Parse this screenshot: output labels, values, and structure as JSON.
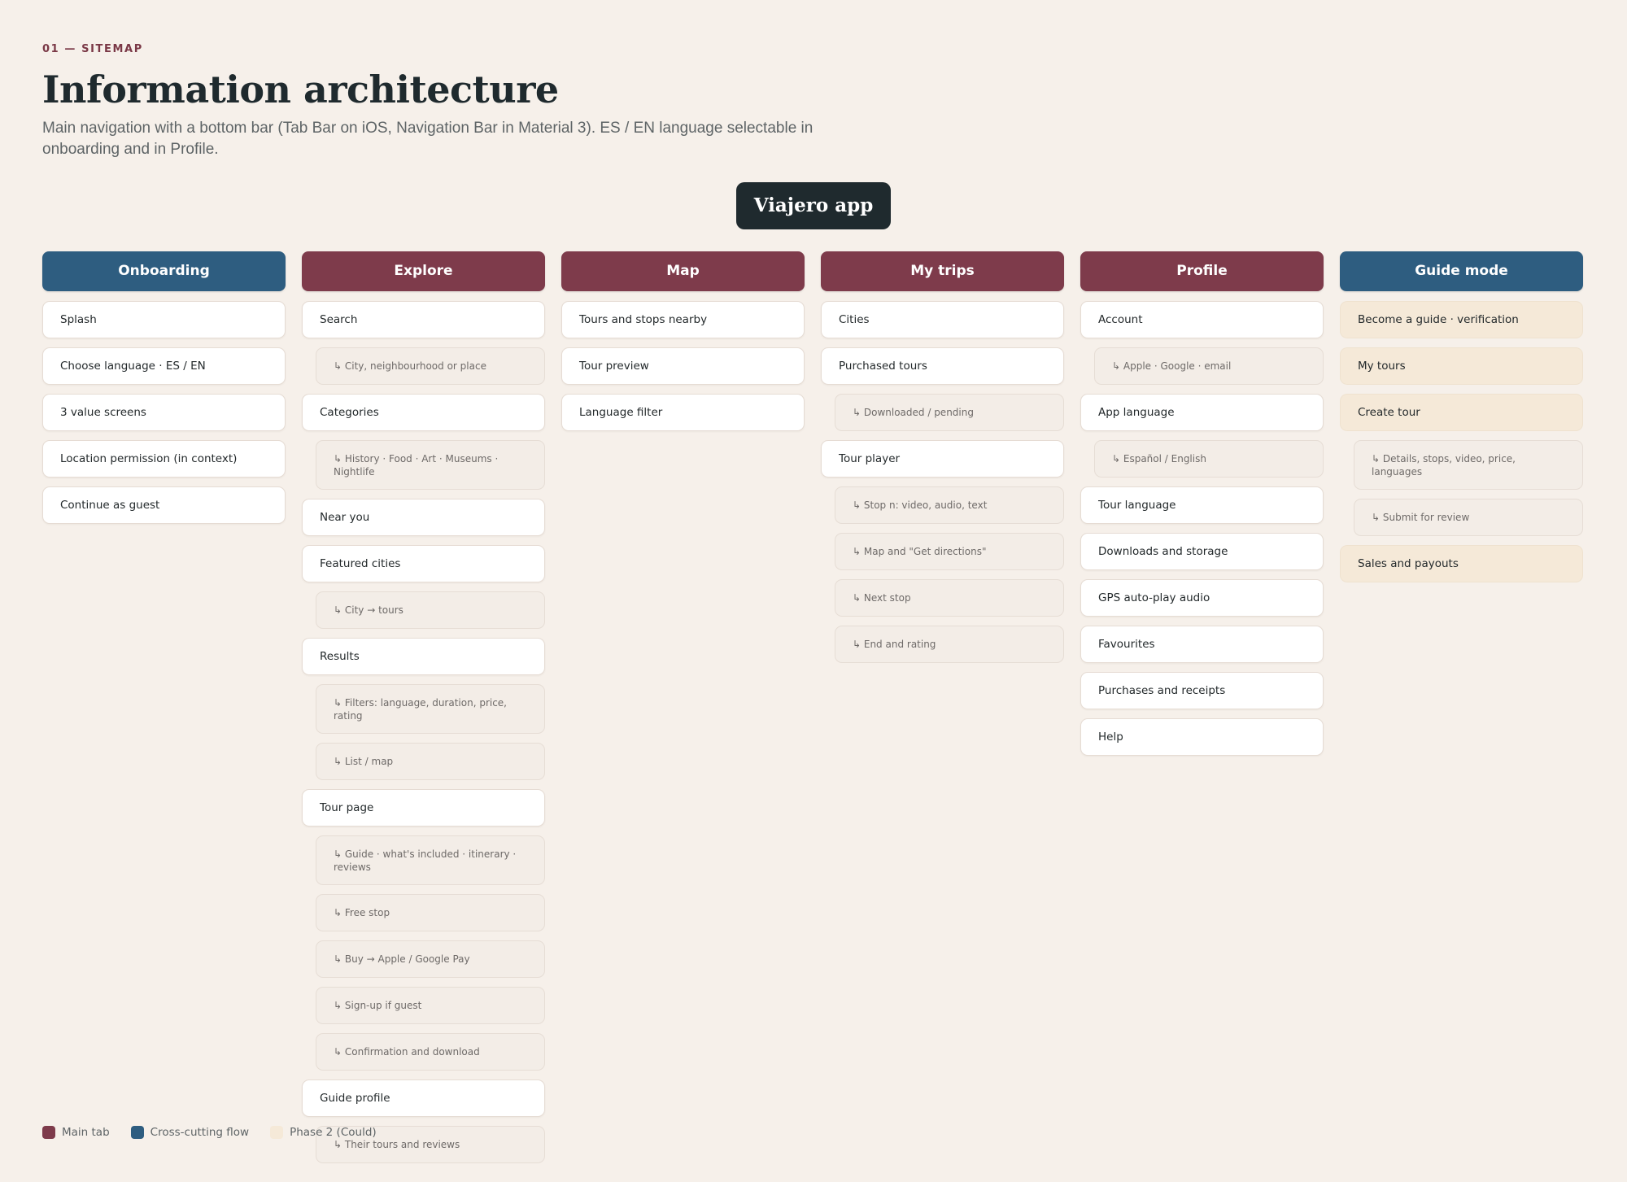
{
  "header": {
    "eyebrow": "01 — SITEMAP",
    "title": "Information architecture",
    "subtitle": "Main navigation with a bottom bar (Tab Bar on iOS, Navigation Bar in Material 3). ES / EN language selectable in onboarding and in Profile."
  },
  "root": {
    "label": "Viajero app"
  },
  "colors": {
    "main_tab": "#7e3b4b",
    "cross_cutting": "#2e5d80",
    "phase2": "#f5e9d8",
    "root": "#1f2a2e"
  },
  "columns": [
    {
      "title": "Onboarding",
      "kind": "cross",
      "items": [
        {
          "label": "Splash",
          "level": 0
        },
        {
          "label": "Choose language · ES / EN",
          "level": 0
        },
        {
          "label": "3 value screens",
          "level": 0
        },
        {
          "label": "Location permission (in context)",
          "level": 0
        },
        {
          "label": "Continue as guest",
          "level": 0
        }
      ]
    },
    {
      "title": "Explore",
      "kind": "main",
      "items": [
        {
          "label": "Search",
          "level": 0
        },
        {
          "label": "↳ City, neighbourhood or place",
          "level": 1
        },
        {
          "label": "Categories",
          "level": 0
        },
        {
          "label": "↳ History · Food · Art · Museums · Nightlife",
          "level": 1
        },
        {
          "label": "Near you",
          "level": 0
        },
        {
          "label": "Featured cities",
          "level": 0
        },
        {
          "label": "↳ City → tours",
          "level": 1
        },
        {
          "label": "Results",
          "level": 0
        },
        {
          "label": "↳ Filters: language, duration, price, rating",
          "level": 1
        },
        {
          "label": "↳ List / map",
          "level": 1
        },
        {
          "label": "Tour page",
          "level": 0
        },
        {
          "label": "↳ Guide · what's included · itinerary · reviews",
          "level": 1
        },
        {
          "label": "↳ Free stop",
          "level": 1
        },
        {
          "label": "↳ Buy → Apple / Google Pay",
          "level": 1
        },
        {
          "label": "↳ Sign-up if guest",
          "level": 1
        },
        {
          "label": "↳ Confirmation and download",
          "level": 1
        },
        {
          "label": "Guide profile",
          "level": 0
        },
        {
          "label": "↳ Their tours and reviews",
          "level": 1
        }
      ]
    },
    {
      "title": "Map",
      "kind": "main",
      "items": [
        {
          "label": "Tours and stops nearby",
          "level": 0
        },
        {
          "label": "Tour preview",
          "level": 0
        },
        {
          "label": "Language filter",
          "level": 0
        }
      ]
    },
    {
      "title": "My trips",
      "kind": "main",
      "items": [
        {
          "label": "Cities",
          "level": 0
        },
        {
          "label": "Purchased tours",
          "level": 0
        },
        {
          "label": "↳ Downloaded / pending",
          "level": 1
        },
        {
          "label": "Tour player",
          "level": 0
        },
        {
          "label": "↳ Stop n: video, audio, text",
          "level": 1
        },
        {
          "label": "↳ Map and \"Get directions\"",
          "level": 1
        },
        {
          "label": "↳ Next stop",
          "level": 1
        },
        {
          "label": "↳ End and rating",
          "level": 1
        }
      ]
    },
    {
      "title": "Profile",
      "kind": "main",
      "items": [
        {
          "label": "Account",
          "level": 0
        },
        {
          "label": "↳ Apple · Google · email",
          "level": 1
        },
        {
          "label": "App language",
          "level": 0
        },
        {
          "label": "↳ Español / English",
          "level": 1
        },
        {
          "label": "Tour language",
          "level": 0
        },
        {
          "label": "Downloads and storage",
          "level": 0
        },
        {
          "label": "GPS auto-play audio",
          "level": 0
        },
        {
          "label": "Favourites",
          "level": 0
        },
        {
          "label": "Purchases and receipts",
          "level": 0
        },
        {
          "label": "Help",
          "level": 0
        }
      ]
    },
    {
      "title": "Guide mode",
      "kind": "cross",
      "items": [
        {
          "label": "Become a guide · verification",
          "level": 0,
          "phase2": true
        },
        {
          "label": "My tours",
          "level": 0,
          "phase2": true
        },
        {
          "label": "Create tour",
          "level": 0,
          "phase2": true
        },
        {
          "label": "↳ Details, stops, video, price, languages",
          "level": 1
        },
        {
          "label": "↳ Submit for review",
          "level": 1
        },
        {
          "label": "Sales and payouts",
          "level": 0,
          "phase2": true
        }
      ]
    }
  ],
  "legend": [
    {
      "label": "Main tab",
      "color": "#7e3b4b"
    },
    {
      "label": "Cross-cutting flow",
      "color": "#2e5d80"
    },
    {
      "label": "Phase 2 (Could)",
      "color": "#f5e9d8"
    }
  ]
}
